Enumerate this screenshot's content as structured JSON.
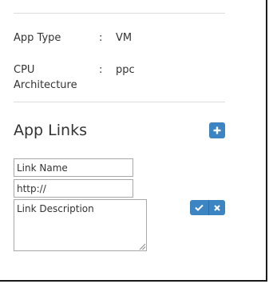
{
  "details": [
    {
      "label": "App Type",
      "colon": ":",
      "value": "VM"
    },
    {
      "label": "CPU Architecture",
      "colon": ":",
      "value": "ppc"
    }
  ],
  "app_links": {
    "title": "App Links",
    "add_icon": "plus-icon",
    "link_name_value": "Link Name",
    "url_value": "http://",
    "description_value": "Link Description",
    "confirm_icon": "check-icon",
    "cancel_icon": "close-icon"
  },
  "colors": {
    "accent": "#3c84c2",
    "divider": "#dcdcdc",
    "text": "#333333"
  }
}
